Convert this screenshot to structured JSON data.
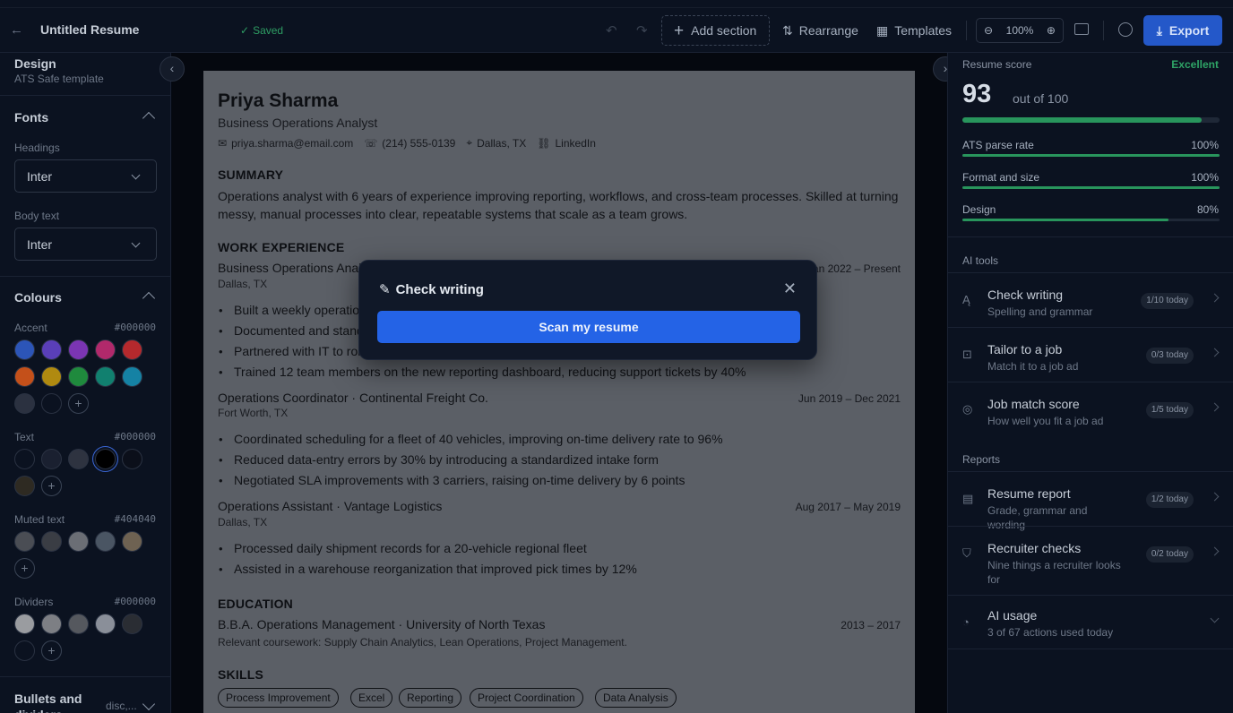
{
  "topbar": {
    "title": "Untitled Resume",
    "saved": "Saved",
    "add_section": "Add section",
    "rearrange": "Rearrange",
    "templates": "Templates",
    "zoom": "100%",
    "export": "Export"
  },
  "left": {
    "design_title": "Design",
    "design_sub": "ATS Safe template",
    "fonts_title": "Fonts",
    "headings_label": "Headings",
    "headings_value": "Inter",
    "body_label": "Body text",
    "body_value": "Inter",
    "colours_title": "Colours",
    "accent_label": "Accent",
    "accent_hex": "#000000",
    "accent_swatches": [
      "#2c55b8",
      "#5a3fb8",
      "#7b35b3",
      "#b1296b",
      "#b5292d",
      "#c4501a",
      "#b08a10",
      "#1f8a3d",
      "#11806f",
      "#1582a4",
      "#2b3140",
      "#0b1220"
    ],
    "text_label": "Text",
    "text_hex": "#000000",
    "text_swatches": [
      "#0b1220",
      "#1a2030",
      "#2e3340",
      "#000000",
      "#0b0f1a",
      "#2e2a22"
    ],
    "muted_label": "Muted text",
    "muted_hex": "#404040",
    "muted_swatches": [
      "#4a4d54",
      "#3a3d44",
      "#6b6e75",
      "#4a5563",
      "#6e6252"
    ],
    "dividers_label": "Dividers",
    "dividers_hex": "#000000",
    "dividers_swatches": [
      "#9a9ca0",
      "#7d7f84",
      "#55585e",
      "#8a8f99",
      "#2a2d33",
      "#0b1220"
    ],
    "bullets_title": "Bullets and dividers",
    "bullets_value": "disc,..."
  },
  "resume": {
    "name": "Priya Sharma",
    "role": "Business Operations Analyst",
    "email": "priya.sharma@email.com",
    "phone": "(214) 555-0139",
    "location": "Dallas, TX",
    "link": "LinkedIn",
    "summary_h": "SUMMARY",
    "summary": "Operations analyst with 6 years of experience improving reporting, workflows, and cross-team processes. Skilled at turning messy, manual processes into clear, repeatable systems that scale as a team grows.",
    "work_h": "WORK EXPERIENCE",
    "jobs": [
      {
        "title": "Business Operations Analyst",
        "date": "Jan 2022 – Present",
        "loc": "Dallas, TX",
        "bullets": [
          "Built a weekly operations report",
          "Documented and standardized",
          "Partnered with IT to roll out",
          "Trained 12 team members on the new reporting dashboard, reducing support tickets by 40%"
        ]
      },
      {
        "title": "Operations Coordinator · Continental Freight Co.",
        "date": "Jun 2019 – Dec 2021",
        "loc": "Fort Worth, TX",
        "bullets": [
          "Coordinated scheduling for a fleet of 40 vehicles, improving on-time delivery rate to 96%",
          "Reduced data-entry errors by 30% by introducing a standardized intake form",
          "Negotiated SLA improvements with 3 carriers, raising on-time delivery by 6 points"
        ]
      },
      {
        "title": "Operations Assistant · Vantage Logistics",
        "date": "Aug 2017 – May 2019",
        "loc": "Dallas, TX",
        "bullets": [
          "Processed daily shipment records for a 20-vehicle regional fleet",
          "Assisted in a warehouse reorganization that improved pick times by 12%"
        ]
      }
    ],
    "edu_h": "EDUCATION",
    "edu_title": "B.B.A. Operations Management · University of North Texas",
    "edu_date": "2013 – 2017",
    "edu_note": "Relevant coursework: Supply Chain Analytics, Lean Operations, Project Management.",
    "skills_h": "SKILLS",
    "skills": [
      "Process Improvement",
      "Excel",
      "Reporting",
      "Project Coordination",
      "Data Analysis"
    ]
  },
  "right": {
    "score_label": "Resume score",
    "score_grade": "Excellent",
    "score": "93",
    "out_of": "out of 100",
    "score_fraction": 0.93,
    "metrics": [
      {
        "label": "ATS parse rate",
        "value": "100%",
        "fraction": 1.0
      },
      {
        "label": "Format and size",
        "value": "100%",
        "fraction": 1.0
      },
      {
        "label": "Design",
        "value": "80%",
        "fraction": 0.8
      }
    ],
    "ai_tools_title": "AI tools",
    "tools": [
      {
        "title": "Check writing",
        "sub": "Spelling and grammar",
        "badge": "1/10 today",
        "icon": "spell-check-icon"
      },
      {
        "title": "Tailor to a job",
        "sub": "Match it to a job ad",
        "badge": "0/3 today",
        "icon": "briefcase-icon"
      },
      {
        "title": "Job match score",
        "sub": "How well you fit a job ad",
        "badge": "1/5 today",
        "icon": "target-icon"
      }
    ],
    "reports_title": "Reports",
    "reports": [
      {
        "title": "Resume report",
        "sub": "Grade, grammar and wording",
        "badge": "1/2 today",
        "icon": "document-icon"
      },
      {
        "title": "Recruiter checks",
        "sub": "Nine things a recruiter looks for",
        "badge": "0/2 today",
        "icon": "shield-icon"
      }
    ],
    "usage_title": "AI usage",
    "usage_sub": "3 of 67 actions used today"
  },
  "modal": {
    "title": "Check writing",
    "scan": "Scan my resume"
  },
  "colors": {
    "accent": "#2463e6",
    "success": "#28955c",
    "export": "#2458c9"
  }
}
